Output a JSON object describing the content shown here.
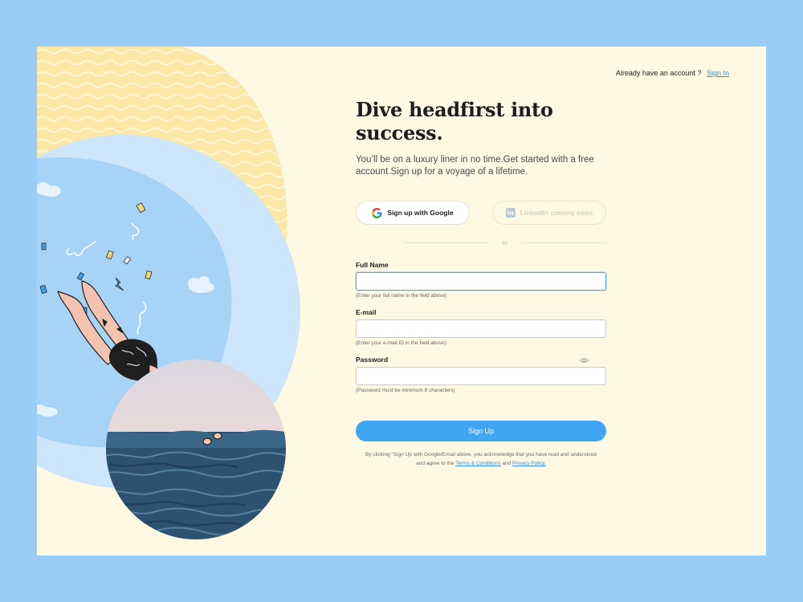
{
  "topbar": {
    "prompt": "Already have an account ?",
    "signin_label": "Sign In"
  },
  "hero": {
    "title": "Dive headfirst into success.",
    "subtitle": "You’ll be on a luxury liner in no time.Get started with a free account.Sign up for a voyage of a lifetime."
  },
  "social": {
    "google_label": "Sign up with Google",
    "linkedin_label": "LinkedIn coming soon",
    "divider_text": "or"
  },
  "form": {
    "full_name": {
      "label": "Full Name",
      "value": "",
      "hint": "(Enter your full name in the field above)"
    },
    "email": {
      "label": "E-mail",
      "value": "",
      "hint": "(Enter your e-mail ID in the field above)"
    },
    "password": {
      "label": "Password",
      "value": "",
      "hint": "(Password must be minimum 8 characters)"
    },
    "submit_label": "Sign Up"
  },
  "legal": {
    "text_before": "By clicking “Sign Up with Google/Email above, you acknowledge that you have read and understood and agree to the ",
    "terms_label": "Terms & Conditions",
    "and_text": " and ",
    "privacy_label": "Privacy Policy."
  },
  "colors": {
    "page_background": "#99cdf8",
    "card_background": "#fff9e3",
    "accent_blue": "#40a6f4",
    "wave_yellow": "#fbe7a6"
  },
  "icons": {
    "google": "google-logo-icon",
    "linkedin": "linkedin-logo-icon",
    "password_toggle": "eye-icon"
  }
}
